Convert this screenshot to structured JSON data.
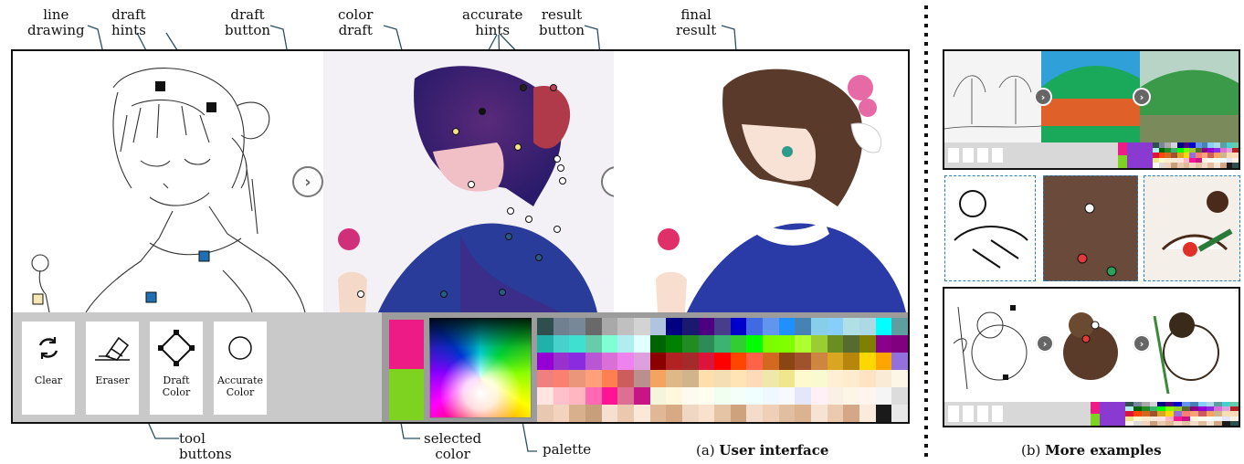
{
  "labels": {
    "line_drawing": "line\ndrawing",
    "draft_hints": "draft\nhints",
    "draft_button": "draft\nbutton",
    "color_draft": "color\ndraft",
    "accurate_hints": "accurate\nhints",
    "result_button": "result\nbutton",
    "final_result": "final\nresult",
    "tool_buttons": "tool\nbuttons",
    "selected_color": "selected\ncolor",
    "palette": "palette"
  },
  "captions": {
    "a_prefix": "(a) ",
    "a_bold": "User interface",
    "b_prefix": "(b) ",
    "b_bold": "More examples"
  },
  "tools": [
    {
      "name": "clear",
      "label": "Clear",
      "icon": "refresh-icon"
    },
    {
      "name": "eraser",
      "label": "Eraser",
      "icon": "eraser-icon"
    },
    {
      "name": "draft-color",
      "label": "Draft\nColor",
      "icon": "diamond-icon"
    },
    {
      "name": "accurate-color",
      "label": "Accurate\nColor",
      "icon": "circle-icon"
    }
  ],
  "selected_colors": [
    "#ec1b86",
    "#7ed321"
  ],
  "palette_colors": [
    "#2f4f4f",
    "#708090",
    "#778899",
    "#696969",
    "#a9a9a9",
    "#c0c0c0",
    "#d3d3d3",
    "#b0c4de",
    "#000080",
    "#191970",
    "#4b0082",
    "#483d8b",
    "#0000cd",
    "#4169e1",
    "#6495ed",
    "#1e90ff",
    "#4682b4",
    "#87ceeb",
    "#87cefa",
    "#b0e0e6",
    "#add8e6",
    "#00ffff",
    "#5f9ea0",
    "#20b2aa",
    "#48d1cc",
    "#40e0d0",
    "#66cdaa",
    "#7fffd4",
    "#afeeee",
    "#e0ffff",
    "#006400",
    "#008000",
    "#228b22",
    "#2e8b57",
    "#3cb371",
    "#32cd32",
    "#00ff00",
    "#7cfc00",
    "#7fff00",
    "#adff2f",
    "#9acd32",
    "#6b8e23",
    "#556b2f",
    "#808000",
    "#8b008b",
    "#800080",
    "#9400d3",
    "#9932cc",
    "#8a2be2",
    "#ba55d3",
    "#da70d6",
    "#ee82ee",
    "#dda0dd",
    "#8b0000",
    "#b22222",
    "#a52a2a",
    "#dc143c",
    "#ff0000",
    "#ff4500",
    "#ff6347",
    "#d2691e",
    "#8b4513",
    "#a0522d",
    "#cd853f",
    "#daa520",
    "#b8860b",
    "#ffd700",
    "#ffa500",
    "#9370db",
    "#f08080",
    "#fa8072",
    "#e9967a",
    "#ffa07a",
    "#ff7f50",
    "#cd5c5c",
    "#bc8f8f",
    "#f4a460",
    "#deb887",
    "#d2b48c",
    "#ffdead",
    "#f5deb3",
    "#ffe4b5",
    "#ffdab9",
    "#eee8aa",
    "#f0e68c",
    "#fffacd",
    "#fafad2",
    "#ffefd5",
    "#ffebcd",
    "#ffe4c4",
    "#faebd7",
    "#fdf5e6",
    "#ffe4e1",
    "#ffc0cb",
    "#ffb6c1",
    "#ff69b4",
    "#ff1493",
    "#db7093",
    "#c71585",
    "#f5f5dc",
    "#fff8dc",
    "#fffaf0",
    "#fffff0",
    "#f0fff0",
    "#f5fffa",
    "#f0ffff",
    "#f0f8ff",
    "#f8f8ff",
    "#e6e6fa",
    "#fff0f5",
    "#faf0e6",
    "#fdf5e6",
    "#fff5ee",
    "#f5f5f5",
    "#dcdcdc",
    "#e8c8b0",
    "#f2d3bd",
    "#d9b08c",
    "#c89f7b",
    "#f5e0cf",
    "#eac9ae",
    "#fbe8d8",
    "#e0b896",
    "#d7a985",
    "#f0d7c3",
    "#f9e1cc",
    "#e5c4a6",
    "#cfa27e",
    "#f3dccb",
    "#efcfb6",
    "#e2bea0",
    "#dcb391",
    "#f7e3d3",
    "#ebcab0",
    "#d4a887",
    "#fcebdc",
    "#1a1a1a",
    "#e8e8e8"
  ]
}
